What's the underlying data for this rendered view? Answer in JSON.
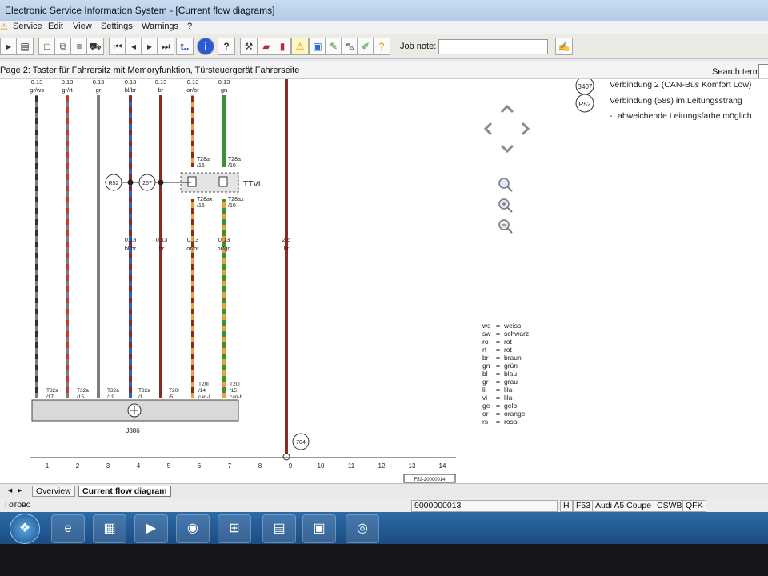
{
  "window": {
    "title": "Electronic Service Information System - [Current flow diagrams]"
  },
  "menu": [
    "Service",
    "Edit",
    "View",
    "Settings",
    "Warnings",
    "?"
  ],
  "toolbar": {
    "job_note_label": "Job note:",
    "job_note_value": "",
    "t_button": "t..",
    "info_button": "i",
    "help_button": "?"
  },
  "page_header": {
    "title": "Page 2: Taster für Fahrersitz mit Memoryfunktion, Türsteuergerät Fahrerseite",
    "search_label": "Search term:",
    "search_value": ""
  },
  "notes": [
    {
      "badge": "B407",
      "text": "Verbindung 2 (CAN-Bus Komfort Low)"
    },
    {
      "badge": "R52",
      "text": "Verbindung (58s) im Leitungsstrang"
    },
    {
      "badge": "",
      "text": "abweichende Leitungsfarbe möglich"
    }
  ],
  "wires_top": [
    {
      "size": "0.13",
      "color": "gr/ws"
    },
    {
      "size": "0.13",
      "color": "gr/rt"
    },
    {
      "size": "0.13",
      "color": "gr"
    },
    {
      "size": "0.13",
      "color": "bl/br"
    },
    {
      "size": "0.13",
      "color": "br"
    },
    {
      "size": "0.13",
      "color": "or/br"
    },
    {
      "size": "0.13",
      "color": "gn"
    }
  ],
  "wires_mid": [
    {
      "size": "0.13",
      "color": "bl/br"
    },
    {
      "size": "0.13",
      "color": "br"
    },
    {
      "size": "0.13",
      "color": "or/br"
    },
    {
      "size": "0.13",
      "color": "or/gn"
    },
    {
      "size": "2.5",
      "color": "br"
    }
  ],
  "connector_ttvl": {
    "name": "TTVL",
    "top_pins": [
      {
        "id": "T28a",
        "pin": "/16"
      },
      {
        "id": "T28a",
        "pin": "/10"
      }
    ],
    "bottom_pins": [
      {
        "id": "T28ax",
        "pin": "/16"
      },
      {
        "id": "T28ax",
        "pin": "/10"
      }
    ]
  },
  "junctions": [
    "R52",
    "267"
  ],
  "ground_point": "704",
  "component": {
    "name": "J386",
    "pins": [
      {
        "id": "T32a",
        "pin": "/17"
      },
      {
        "id": "T32a",
        "pin": "/15"
      },
      {
        "id": "T32a",
        "pin": "/19"
      },
      {
        "id": "T32a",
        "pin": "/1"
      },
      {
        "id": "T20l",
        "pin": "/5"
      },
      {
        "id": "T20l",
        "pin": "/14",
        "sub": "can-l"
      },
      {
        "id": "T20l",
        "pin": "/15",
        "sub": "can-h"
      }
    ]
  },
  "ruler": [
    "1",
    "2",
    "3",
    "4",
    "5",
    "6",
    "7",
    "8",
    "9",
    "10",
    "11",
    "12",
    "13",
    "14"
  ],
  "ruler_code": "F52-20000014",
  "legend": [
    {
      "code": "ws",
      "name": "weiss"
    },
    {
      "code": "sw",
      "name": "schwarz"
    },
    {
      "code": "ro",
      "name": "rot"
    },
    {
      "code": "rt",
      "name": "rot"
    },
    {
      "code": "br",
      "name": "braun"
    },
    {
      "code": "gn",
      "name": "grün"
    },
    {
      "code": "bl",
      "name": "blau"
    },
    {
      "code": "gr",
      "name": "grau"
    },
    {
      "code": "li",
      "name": "lila"
    },
    {
      "code": "vi",
      "name": "lila"
    },
    {
      "code": "ge",
      "name": "gelb"
    },
    {
      "code": "or",
      "name": "orange"
    },
    {
      "code": "rs",
      "name": "rosa"
    }
  ],
  "tabs": {
    "overview": "Overview",
    "current": "Current flow diagram"
  },
  "status": {
    "left": "Готово",
    "order": "9000000013",
    "h": "H",
    "code": "F53",
    "model": "Audi A5 Coupe",
    "engine": "CSWB",
    "trans": "QFK"
  },
  "colors": {
    "gray": "#7d7d7d",
    "red": "#c23b35",
    "blue": "#2b5fd6",
    "brown": "#8a2a22",
    "orange": "#e8a23a",
    "green": "#3f8e3a",
    "black": "#333333"
  }
}
